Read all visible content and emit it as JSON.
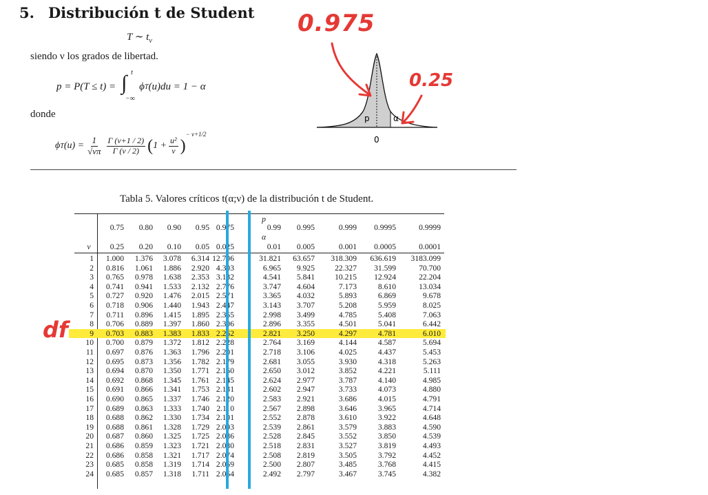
{
  "section": {
    "number": "5.",
    "title": "Distribución t de Student"
  },
  "formulas": {
    "t_def": "T ∼ t",
    "t_def_sub": "ν",
    "nu_text": "siendo ν los grados de libertad.",
    "p_def_left": "p = P(T ≤ t) =",
    "p_def_int_upper": "t",
    "p_def_int_lower": "−∞",
    "p_def_right": "ϕ",
    "p_def_right_sub": "T",
    "p_def_tail": "(u)du = 1 − α",
    "donde": "donde",
    "phi_left": "ϕ",
    "phi_left_sub": "T",
    "phi_left_tail": "(u) =",
    "phi_frac1_num": "1",
    "phi_frac1_den": "√νπ",
    "phi_frac2_num": "Γ (ν+1 / 2)",
    "phi_frac2_den": "Γ (ν / 2)",
    "phi_paren": "1 +",
    "phi_frac3_num": "u²",
    "phi_frac3_den": "ν",
    "phi_exp": "− ν+1/2"
  },
  "distribution_plot": {
    "label_p": "p",
    "label_alpha": "α",
    "label_zero": "0"
  },
  "annotations": {
    "top_value": "0.975",
    "right_value": "0.25",
    "df_label": "df"
  },
  "table": {
    "caption": "Tabla 5. Valores críticos t(α;ν) de la distribución t de Student.",
    "p_label": "p",
    "alpha_label": "α",
    "nu_label": "ν",
    "p_values": [
      "0.75",
      "0.80",
      "0.90",
      "0.95",
      "0.975",
      "0.99",
      "0.995",
      "0.999",
      "0.9995",
      "0.9999"
    ],
    "alpha_values": [
      "0.25",
      "0.20",
      "0.10",
      "0.05",
      "0.025",
      "0.01",
      "0.005",
      "0.001",
      "0.0005",
      "0.0001"
    ],
    "rows": [
      [
        "1",
        "1.000",
        "1.376",
        "3.078",
        "6.314",
        "12.706",
        "31.821",
        "63.657",
        "318.309",
        "636.619",
        "3183.099"
      ],
      [
        "2",
        "0.816",
        "1.061",
        "1.886",
        "2.920",
        "4.303",
        "6.965",
        "9.925",
        "22.327",
        "31.599",
        "70.700"
      ],
      [
        "3",
        "0.765",
        "0.978",
        "1.638",
        "2.353",
        "3.182",
        "4.541",
        "5.841",
        "10.215",
        "12.924",
        "22.204"
      ],
      [
        "4",
        "0.741",
        "0.941",
        "1.533",
        "2.132",
        "2.776",
        "3.747",
        "4.604",
        "7.173",
        "8.610",
        "13.034"
      ],
      [
        "5",
        "0.727",
        "0.920",
        "1.476",
        "2.015",
        "2.571",
        "3.365",
        "4.032",
        "5.893",
        "6.869",
        "9.678"
      ],
      [
        "6",
        "0.718",
        "0.906",
        "1.440",
        "1.943",
        "2.447",
        "3.143",
        "3.707",
        "5.208",
        "5.959",
        "8.025"
      ],
      [
        "7",
        "0.711",
        "0.896",
        "1.415",
        "1.895",
        "2.365",
        "2.998",
        "3.499",
        "4.785",
        "5.408",
        "7.063"
      ],
      [
        "8",
        "0.706",
        "0.889",
        "1.397",
        "1.860",
        "2.306",
        "2.896",
        "3.355",
        "4.501",
        "5.041",
        "6.442"
      ],
      [
        "9",
        "0.703",
        "0.883",
        "1.383",
        "1.833",
        "2.262",
        "2.821",
        "3.250",
        "4.297",
        "4.781",
        "6.010"
      ],
      [
        "10",
        "0.700",
        "0.879",
        "1.372",
        "1.812",
        "2.228",
        "2.764",
        "3.169",
        "4.144",
        "4.587",
        "5.694"
      ],
      [
        "11",
        "0.697",
        "0.876",
        "1.363",
        "1.796",
        "2.201",
        "2.718",
        "3.106",
        "4.025",
        "4.437",
        "5.453"
      ],
      [
        "12",
        "0.695",
        "0.873",
        "1.356",
        "1.782",
        "2.179",
        "2.681",
        "3.055",
        "3.930",
        "4.318",
        "5.263"
      ],
      [
        "13",
        "0.694",
        "0.870",
        "1.350",
        "1.771",
        "2.160",
        "2.650",
        "3.012",
        "3.852",
        "4.221",
        "5.111"
      ],
      [
        "14",
        "0.692",
        "0.868",
        "1.345",
        "1.761",
        "2.145",
        "2.624",
        "2.977",
        "3.787",
        "4.140",
        "4.985"
      ],
      [
        "15",
        "0.691",
        "0.866",
        "1.341",
        "1.753",
        "2.131",
        "2.602",
        "2.947",
        "3.733",
        "4.073",
        "4.880"
      ],
      [
        "16",
        "0.690",
        "0.865",
        "1.337",
        "1.746",
        "2.120",
        "2.583",
        "2.921",
        "3.686",
        "4.015",
        "4.791"
      ],
      [
        "17",
        "0.689",
        "0.863",
        "1.333",
        "1.740",
        "2.110",
        "2.567",
        "2.898",
        "3.646",
        "3.965",
        "4.714"
      ],
      [
        "18",
        "0.688",
        "0.862",
        "1.330",
        "1.734",
        "2.101",
        "2.552",
        "2.878",
        "3.610",
        "3.922",
        "4.648"
      ],
      [
        "19",
        "0.688",
        "0.861",
        "1.328",
        "1.729",
        "2.093",
        "2.539",
        "2.861",
        "3.579",
        "3.883",
        "4.590"
      ],
      [
        "20",
        "0.687",
        "0.860",
        "1.325",
        "1.725",
        "2.086",
        "2.528",
        "2.845",
        "3.552",
        "3.850",
        "4.539"
      ],
      [
        "21",
        "0.686",
        "0.859",
        "1.323",
        "1.721",
        "2.080",
        "2.518",
        "2.831",
        "3.527",
        "3.819",
        "4.493"
      ],
      [
        "22",
        "0.686",
        "0.858",
        "1.321",
        "1.717",
        "2.074",
        "2.508",
        "2.819",
        "3.505",
        "3.792",
        "4.452"
      ],
      [
        "23",
        "0.685",
        "0.858",
        "1.319",
        "1.714",
        "2.069",
        "2.500",
        "2.807",
        "3.485",
        "3.768",
        "4.415"
      ],
      [
        "24",
        "0.685",
        "0.857",
        "1.318",
        "1.711",
        "2.064",
        "2.492",
        "2.797",
        "3.467",
        "3.745",
        "4.382"
      ]
    ],
    "highlight_row": 9,
    "highlight_color": "#ffeb3b",
    "column_marker_color": "#29a8e0",
    "annotation_color": "#e53935"
  }
}
